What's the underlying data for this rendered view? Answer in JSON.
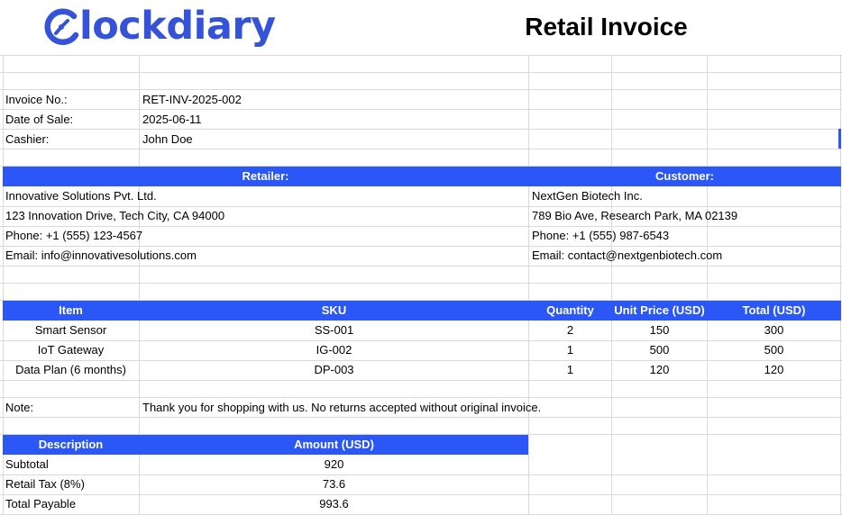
{
  "brand": {
    "name": "Clockdiary",
    "name_rest": "lockdiary",
    "color": "#3553d9"
  },
  "title": "Retail Invoice",
  "invoice": {
    "number_label": "Invoice No.:",
    "number": "RET-INV-2025-002",
    "date_label": "Date of Sale:",
    "date": "2025-06-11",
    "cashier_label": "Cashier:",
    "cashier": "John Doe"
  },
  "parties": {
    "retailer_header": "Retailer:",
    "customer_header": "Customer:",
    "retailer": {
      "name": "Innovative Solutions Pvt. Ltd.",
      "address": "123 Innovation Drive, Tech City, CA 94000",
      "phone": "Phone: +1 (555) 123-4567",
      "email": "Email: info@innovativesolutions.com"
    },
    "customer": {
      "name": "NextGen Biotech Inc.",
      "address": "789 Bio Ave, Research Park, MA 02139",
      "phone": "Phone: +1 (555) 987-6543",
      "email": "Email: contact@nextgenbiotech.com"
    }
  },
  "items": {
    "headers": [
      "Item",
      "SKU",
      "Quantity",
      "Unit Price (USD)",
      "Total (USD)"
    ],
    "rows": [
      [
        "Smart Sensor",
        "SS-001",
        "2",
        "150",
        "300"
      ],
      [
        "IoT Gateway",
        "IG-002",
        "1",
        "500",
        "500"
      ],
      [
        "Data Plan (6 months)",
        "DP-003",
        "1",
        "120",
        "120"
      ]
    ]
  },
  "note": {
    "label": "Note:",
    "text": "Thank you for shopping with us. No returns accepted without original invoice."
  },
  "summary": {
    "headers": [
      "Description",
      "Amount (USD)"
    ],
    "rows": [
      [
        "Subtotal",
        "920"
      ],
      [
        "Retail Tax (8%)",
        "73.6"
      ],
      [
        "Total Payable",
        "993.6"
      ]
    ]
  },
  "colors": {
    "header_band": "#2a57f5",
    "header_text": "#ffffff",
    "gridline": "#d9d9d9"
  }
}
